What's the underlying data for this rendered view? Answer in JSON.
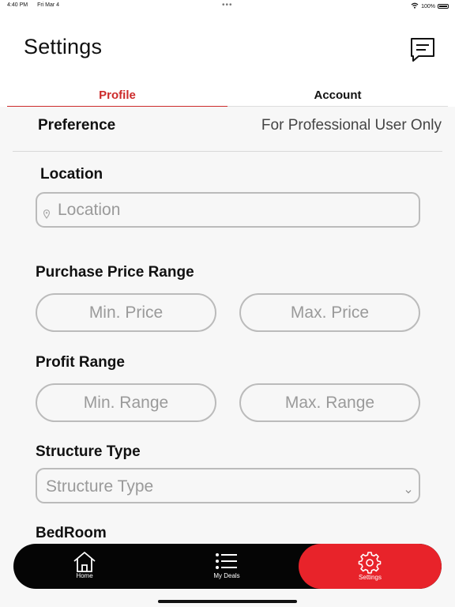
{
  "status_bar": {
    "time": "4:40 PM",
    "date": "Fri Mar 4",
    "battery": "100%"
  },
  "header": {
    "title": "Settings",
    "chat_icon": "chat-icon"
  },
  "tabs": [
    {
      "label": "Profile",
      "active": true
    },
    {
      "label": "Account",
      "active": false
    }
  ],
  "preference": {
    "label": "Preference",
    "note": "For Professional User Only"
  },
  "form": {
    "location": {
      "label": "Location",
      "placeholder": "Location"
    },
    "purchase_price": {
      "label": "Purchase Price Range",
      "min_placeholder": "Min. Price",
      "max_placeholder": "Max. Price"
    },
    "profit_range": {
      "label": "Profit Range",
      "min_placeholder": "Min. Range",
      "max_placeholder": "Max. Range"
    },
    "structure_type": {
      "label": "Structure Type",
      "placeholder": "Structure Type"
    },
    "bedroom": {
      "label": "BedRoom"
    }
  },
  "bottom_nav": {
    "items": [
      {
        "label": "Home",
        "icon": "home-icon"
      },
      {
        "label": "My Deals",
        "icon": "list-icon"
      },
      {
        "label": "Settings",
        "icon": "gear-icon",
        "active": true
      }
    ]
  },
  "colors": {
    "accent": "#e8232a",
    "tab_active": "#cc2b2b",
    "nav_bg": "#050505"
  }
}
